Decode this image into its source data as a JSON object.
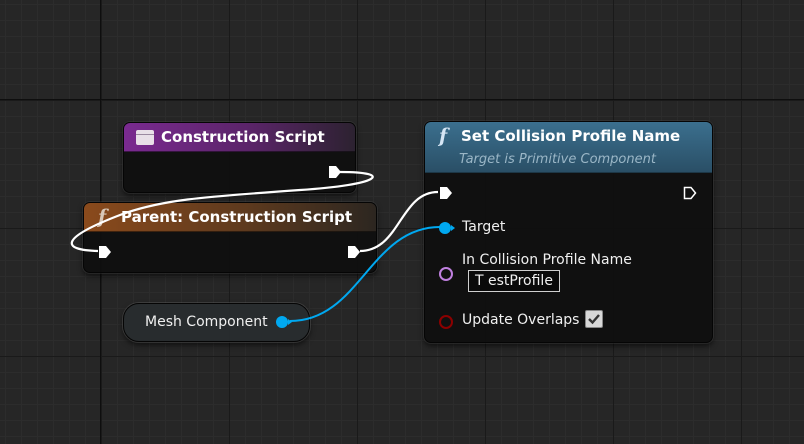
{
  "nodes": {
    "construction_script": {
      "title": "Construction Script",
      "icon": "event-icon"
    },
    "parent_construction_script": {
      "title": "Parent: Construction Script",
      "icon": "function-icon"
    },
    "set_collision_profile_name": {
      "title": "Set Collision Profile Name",
      "subtitle": "Target is Primitive Component",
      "icon": "function-icon",
      "pins": {
        "target_label": "Target",
        "in_profile_label": "In Collision Profile Name",
        "in_profile_value": "T estProfile",
        "update_overlaps_label": "Update Overlaps",
        "update_overlaps_checked": true
      }
    },
    "mesh_component": {
      "label": "Mesh Component"
    }
  },
  "colors": {
    "exec_wire": "#ffffff",
    "object_pin": "#00a8f0",
    "name_pin": "#c080e0",
    "bool_pin": "#8c0000",
    "header_event": "#7a2a90",
    "header_parent": "#8a4a1c",
    "header_function": "#3b6f8e"
  }
}
